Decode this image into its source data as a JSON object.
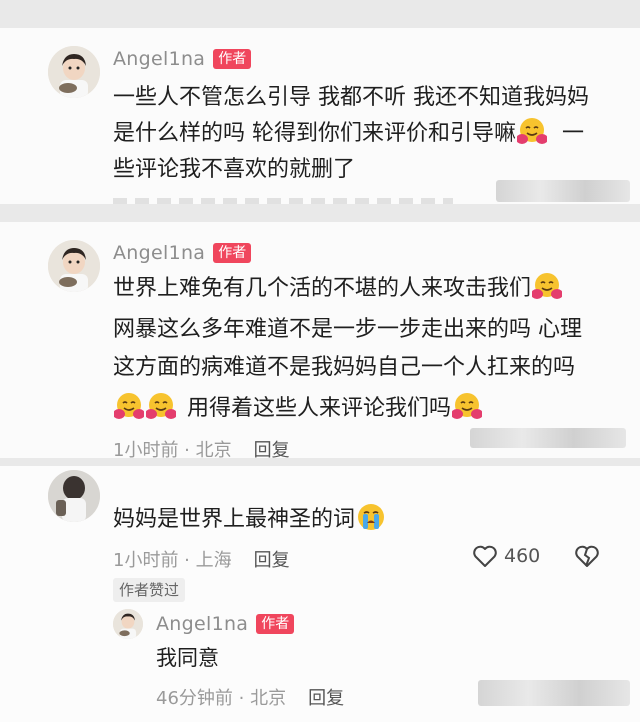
{
  "comments": [
    {
      "username": "Angel1na",
      "badge": "作者",
      "lines": [
        "一些人不管怎么引导 我都不听 我还不知道我妈妈",
        "是什么样的吗 轮得到你们来评价和引导嘛",
        "一",
        "些评论我不喜欢的就删了"
      ],
      "emoji": "hugging-face-emoji"
    },
    {
      "username": "Angel1na",
      "badge": "作者",
      "lines": [
        "世界上难免有几个活的不堪的人来攻击我们",
        "网暴这么多年难道不是一步一步走出来的吗 心理",
        "这方面的病难道不是我妈妈自己一个人扛来的吗",
        "用得着这些人来评论我们吗"
      ],
      "time": "1小时前 · 北京",
      "reply_label": "回复",
      "emoji": "hugging-face-emoji"
    },
    {
      "text": "妈妈是世界上最神圣的词",
      "emoji": "crying-face-emoji",
      "time": "1小时前 · 上海",
      "reply_label": "回复",
      "likes": "460",
      "author_liked_tag": "作者赞过",
      "reply": {
        "username": "Angel1na",
        "badge": "作者",
        "text": "我同意",
        "time": "46分钟前 · 北京",
        "reply_label": "回复"
      }
    }
  ],
  "colors": {
    "badge": "#f0465d",
    "background": "#fbfbfb",
    "separator": "#e9e9e9",
    "meta": "#9a9a9a"
  }
}
